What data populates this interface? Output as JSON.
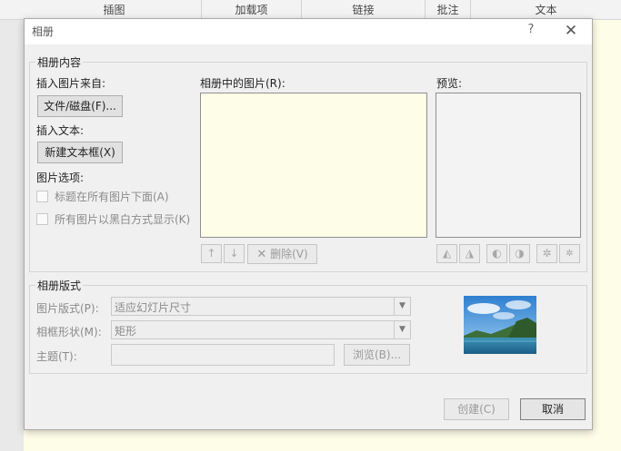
{
  "ribbon": {
    "groups": [
      "插图",
      "加载项",
      "链接",
      "批注",
      "文本"
    ]
  },
  "dialog": {
    "title": "相册",
    "help_glyph": "?",
    "close_glyph": "✕",
    "content_group": {
      "title": "相册内容",
      "insert_from_label": "插入图片来自:",
      "file_disk_button": "文件/磁盘(F)...",
      "insert_text_label": "插入文本:",
      "new_textbox_button": "新建文本框(X)",
      "picture_options_label": "图片选项:",
      "caption_option": "标题在所有图片下面(A)",
      "bw_option": "所有图片以黑白方式显示(K)",
      "pictures_in_album_label": "相册中的图片(R):",
      "preview_label": "预览:",
      "move_up_glyph": "↑",
      "move_down_glyph": "↓",
      "delete_glyph": "✕",
      "delete_button": "删除(V)",
      "rotate_left_glyph": "◭",
      "rotate_right_glyph": "◮",
      "contrast_up_glyph": "◐",
      "contrast_down_glyph": "◑",
      "brightness_up_glyph": "✲",
      "brightness_down_glyph": "✲"
    },
    "layout_group": {
      "title": "相册版式",
      "picture_layout_label": "图片版式(P):",
      "picture_layout_value": "适应幻灯片尺寸",
      "frame_shape_label": "相框形状(M):",
      "frame_shape_value": "矩形",
      "theme_label": "主题(T):",
      "theme_value": "",
      "browse_button": "浏览(B)...",
      "dropdown_glyph": "▼"
    },
    "create_button": "创建(C)",
    "cancel_button": "取消"
  }
}
